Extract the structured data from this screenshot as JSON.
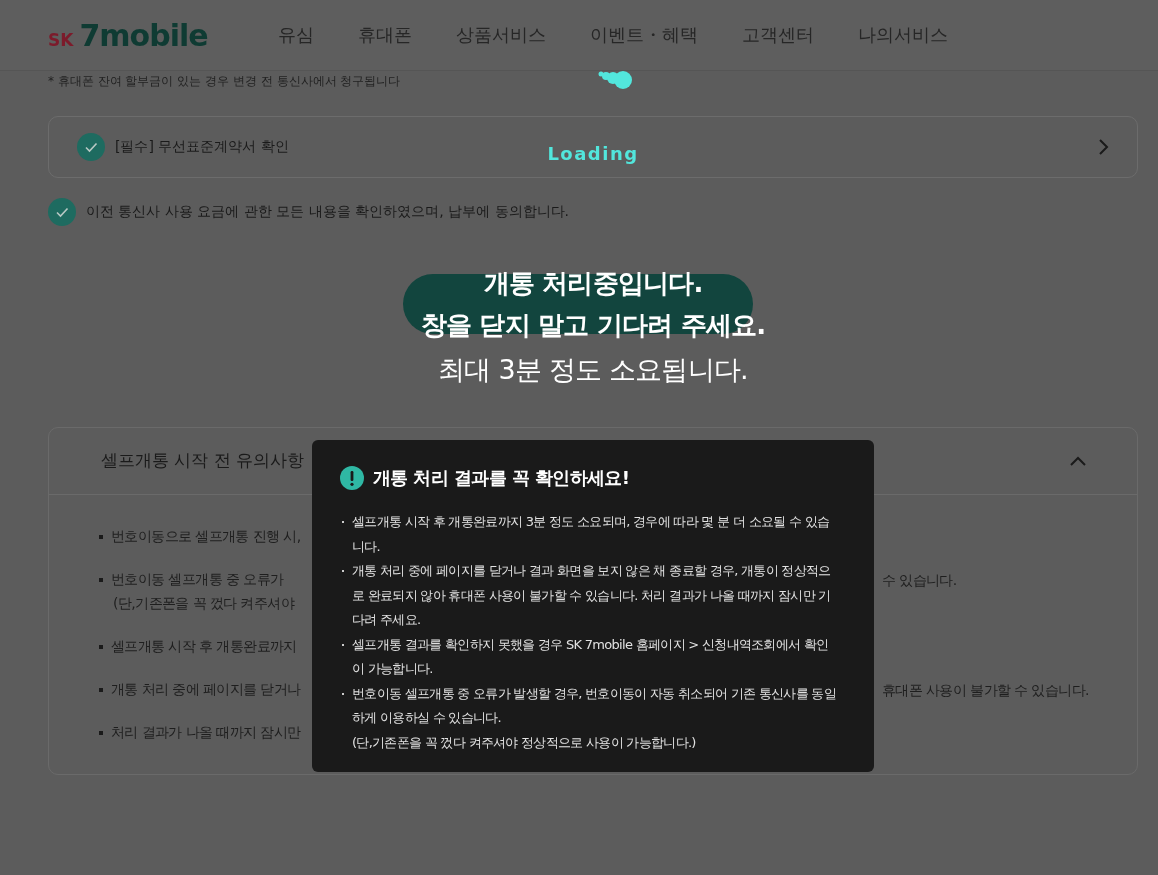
{
  "header": {
    "logo": {
      "brand": "SK",
      "product": "7mobile"
    },
    "nav": [
      "유심",
      "휴대폰",
      "상품서비스",
      "이벤트・혜택",
      "고객센터",
      "나의서비스"
    ]
  },
  "footnote": "* 휴대폰 잔여 할부금이 있는 경우 변경 전 통신사에서 청구됩니다",
  "agreement": {
    "label": "[필수] 무선표준계약서 확인",
    "checked": true
  },
  "consent": {
    "label": "이전 통신사 사용 요금에 관한 모든 내용을 확인하였으며, 납부에 동의합니다.",
    "checked": true
  },
  "start_button": {
    "kind": "pill"
  },
  "notice": {
    "title": "셀프개통 시작 전 유의사항",
    "expanded": true,
    "items": [
      {
        "lines": [
          {
            "left": "번호이동으로 셀프개통 진행 시,"
          }
        ]
      },
      {
        "lines": [
          {
            "left": "번호이동 셀프개통 중 오류가",
            "right": "수 있습니다."
          },
          {
            "left": "(단,기존폰을 꼭 껐다 켜주셔야"
          }
        ]
      },
      {
        "lines": [
          {
            "left": "셀프개통 시작 후 개통완료까지"
          }
        ]
      },
      {
        "lines": [
          {
            "left": "개통 처리 중에 페이지를 닫거나",
            "right": "휴대폰 사용이 불가할 수 있습니다."
          }
        ]
      },
      {
        "lines": [
          {
            "left": "처리 결과가 나올 때까지 잠시만"
          }
        ]
      }
    ]
  },
  "loading": {
    "label": "Loading",
    "headline": [
      "개통 처리중입니다.",
      "창을 닫지 말고 기다려 주세요."
    ],
    "subline": "최대 3분 정도 소요됩니다."
  },
  "result_notice": {
    "title": "개통 처리 결과를 꼭 확인하세요!",
    "items": [
      {
        "lines": [
          "셀프개통 시작 후 개통완료까지 3분 정도 소요되며, 경우에 따라 몇 분 더 소요될 수 있습니다."
        ]
      },
      {
        "lines": [
          "개통 처리 중에 페이지를 닫거나 결과 화면을 보지 않은 채 종료할 경우, 개통이 정상적으로 완료되지 않아 휴대폰 사용이 불가할 수 있습니다. 처리 결과가 나올 때까지 잠시만 기다려 주세요."
        ]
      },
      {
        "lines": [
          "셀프개통 결과를 확인하지 못했을 경우 SK 7mobile 홈페이지 > 신청내역조회에서 확인이 가능합니다."
        ]
      },
      {
        "lines": [
          "번호이동 셀프개통 중 오류가 발생할 경우, 번호이동이 자동 취소되어 기존 통신사를 동일하게 이용하실 수 있습니다.",
          "(단,기존폰을 꼭 껐다 켜주셔야 정상적으로 사용이 가능합니다.)"
        ]
      }
    ]
  }
}
